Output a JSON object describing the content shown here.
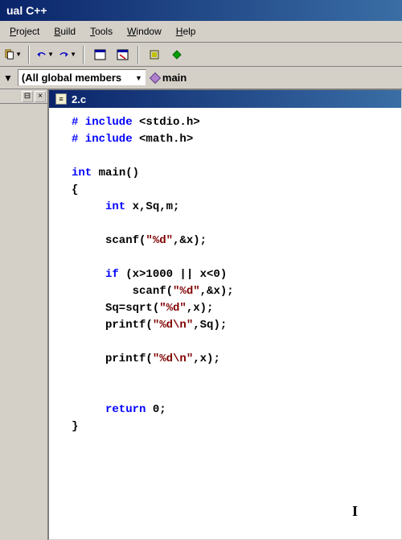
{
  "title": "ual C++",
  "menu": {
    "project": "Project",
    "build": "Build",
    "tools": "Tools",
    "window": "Window",
    "help": "Help"
  },
  "scope": {
    "dropdown": "(All global members",
    "function": "main"
  },
  "file": {
    "name": "2.c"
  },
  "code": {
    "l1a": "# include ",
    "l1b": "<stdio.h>",
    "l2a": "# include ",
    "l2b": "<math.h>",
    "l3a": "int",
    "l3b": " main()",
    "l4": "{",
    "l5a": "     int",
    "l5b": " x,Sq,m;",
    "l6a": "     scanf(",
    "l6b": "\"%d\"",
    "l6c": ",&x);",
    "l7a": "     if",
    "l7b": " (x>1000 || x<0)",
    "l8a": "         scanf(",
    "l8b": "\"%d\"",
    "l8c": ",&x);",
    "l9a": "     Sq=sqrt(",
    "l9b": "\"%d\"",
    "l9c": ",x);",
    "l10a": "     printf(",
    "l10b": "\"%d\\n\"",
    "l10c": ",Sq);",
    "l11a": "     printf(",
    "l11b": "\"%d\\n\"",
    "l11c": ",x);",
    "l12a": "     return",
    "l12b": " 0;",
    "l13": "}"
  }
}
